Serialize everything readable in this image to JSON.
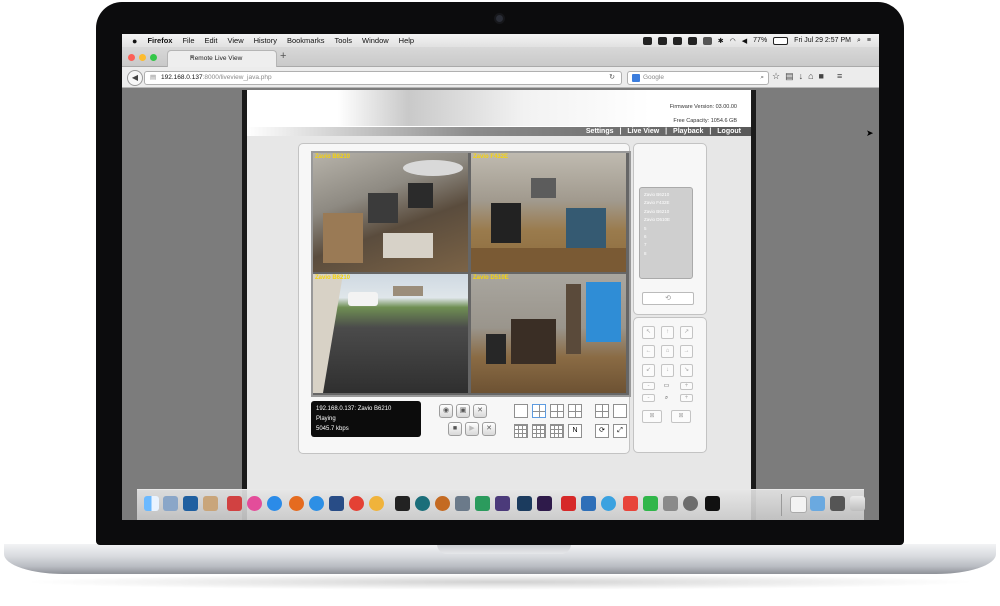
{
  "menubar": {
    "app_name": "Firefox",
    "menus": [
      "File",
      "Edit",
      "View",
      "History",
      "Bookmarks",
      "Tools",
      "Window",
      "Help"
    ],
    "battery": "77%",
    "datetime": "Fri Jul 29  2:57 PM"
  },
  "browser": {
    "tab_title": "Remote Live View",
    "tab_close": "×",
    "new_tab": "+",
    "url_host": "192.168.0.137",
    "url_path": ":8000/liveview_java.php",
    "search_engine_label": "Google"
  },
  "page": {
    "firmware": "Firmware Version: 03.00.00",
    "free_capacity": "Free Capacity: 1054.6 GB",
    "nav": {
      "settings": "Settings",
      "live_view": "Live View",
      "playback": "Playback",
      "logout": "Logout",
      "sep": "|"
    },
    "cameras": [
      {
        "label": "Zavio B6210"
      },
      {
        "label": "Zavio F432E"
      },
      {
        "label": "Zavio B6210"
      },
      {
        "label": "Zavio D510E"
      }
    ],
    "status": {
      "line1": "192.168.0.137: Zavio B6210",
      "line2": "Playing",
      "line3": "5045.7 kbps"
    },
    "camera_list": [
      "Zavio B6210",
      "Zavio F432E",
      "Zavio B6210",
      "Zavio D510E",
      "5",
      "6",
      "7",
      "8"
    ],
    "refresh_glyph": "⟲"
  },
  "colors": {
    "camera_label": "#f6d30a",
    "status_bg": "#0c0c0c"
  }
}
